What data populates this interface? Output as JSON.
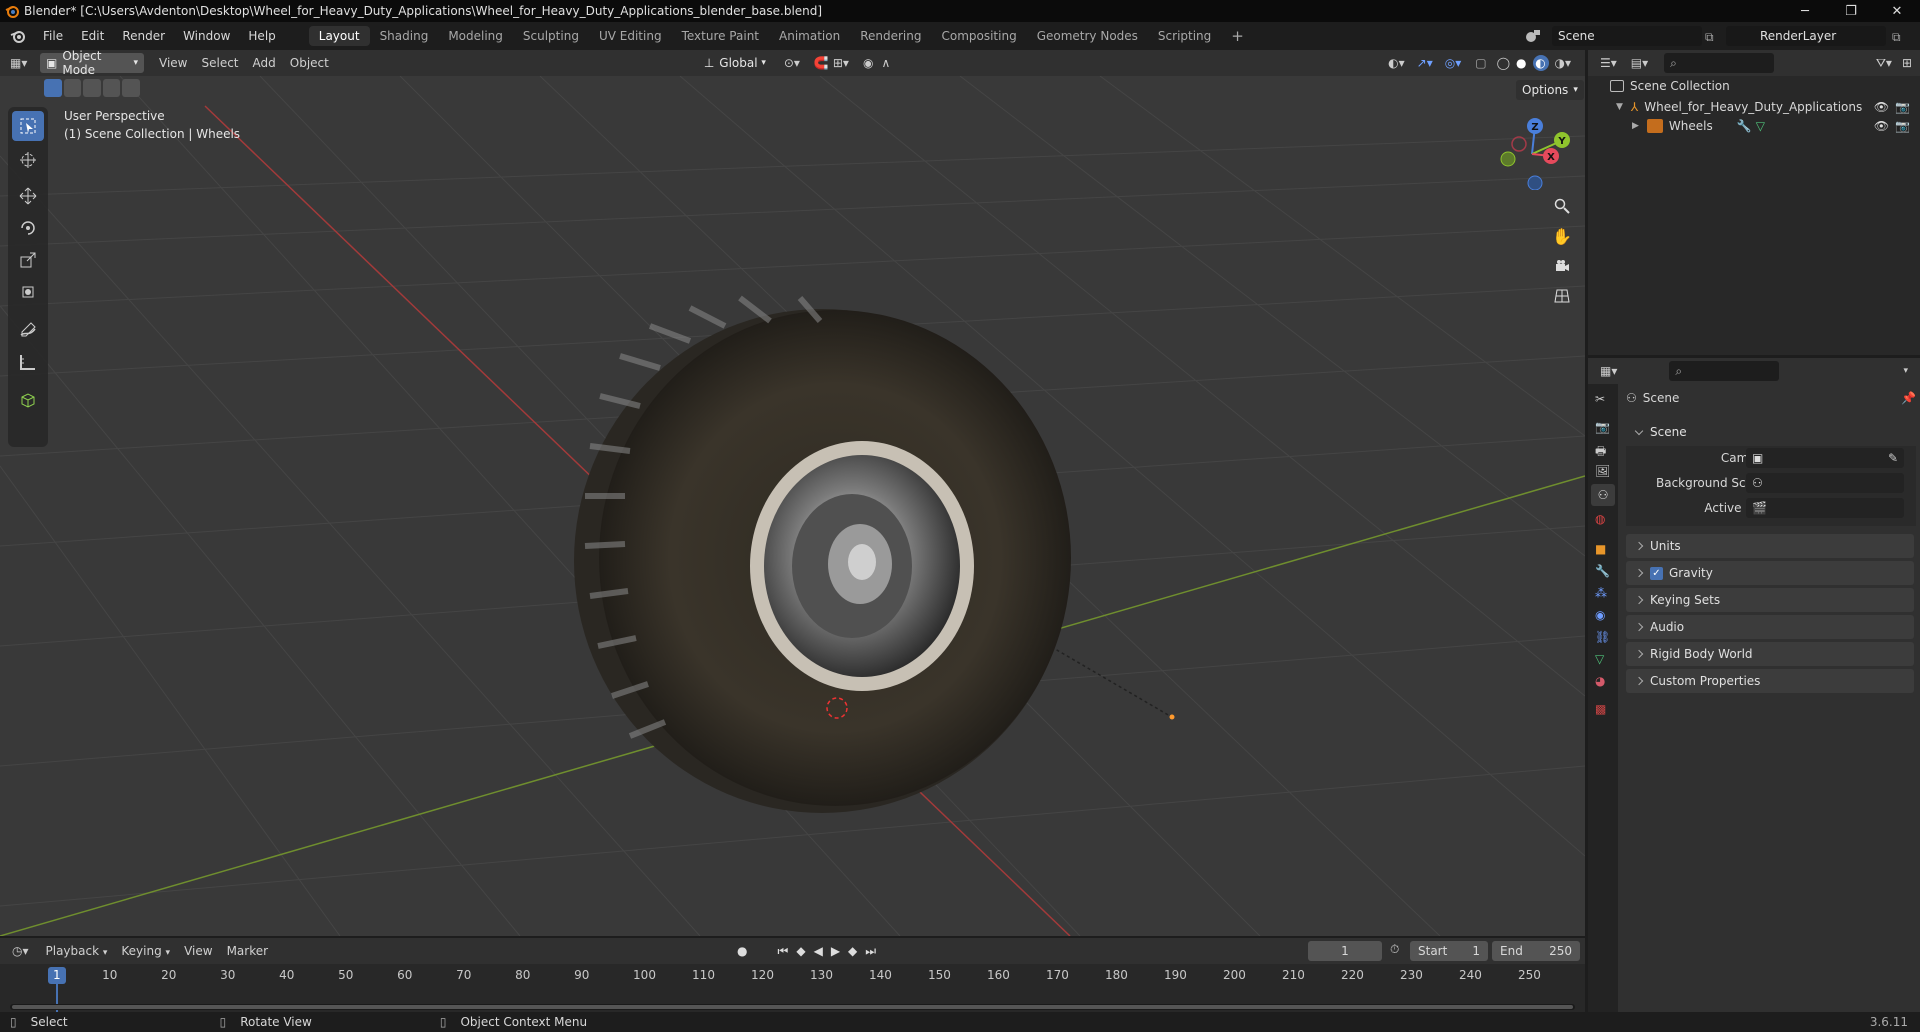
{
  "window": {
    "title": "Blender* [C:\\Users\\Avdenton\\Desktop\\Wheel_for_Heavy_Duty_Applications\\Wheel_for_Heavy_Duty_Applications_blender_base.blend]",
    "controls": [
      "─",
      "❐",
      "✕"
    ]
  },
  "menu": [
    "File",
    "Edit",
    "Render",
    "Window",
    "Help"
  ],
  "workspaces": [
    "Layout",
    "Shading",
    "Modeling",
    "Sculpting",
    "UV Editing",
    "Texture Paint",
    "Animation",
    "Rendering",
    "Compositing",
    "Geometry Nodes",
    "Scripting"
  ],
  "scene_field": "Scene",
  "renderlayer_field": "RenderLayer",
  "viewport_header": {
    "mode": "Object Mode",
    "menus": [
      "View",
      "Select",
      "Add",
      "Object"
    ],
    "transform_orientation": "Global",
    "options": "Options"
  },
  "viewport": {
    "perspective": "User Perspective",
    "collection": "(1) Scene Collection | Wheels"
  },
  "gizmo": {
    "z": "Z",
    "y": "Y",
    "x": "X"
  },
  "outliner": {
    "root": "Scene Collection",
    "items": [
      "Wheel_for_Heavy_Duty_Applications",
      "Wheels"
    ]
  },
  "properties": {
    "context": "Scene",
    "section": "Scene",
    "fields": [
      "Camera",
      "Background Scene",
      "Active Clip"
    ],
    "panels": [
      "Units",
      "Gravity",
      "Keying Sets",
      "Audio",
      "Rigid Body World",
      "Custom Properties"
    ]
  },
  "timeline": {
    "menus": [
      "Playback",
      "Keying",
      "View",
      "Marker"
    ],
    "current_frame": "1",
    "start_label": "Start",
    "start": "1",
    "end_label": "End",
    "end": "250",
    "ticks": [
      "1",
      "10",
      "20",
      "30",
      "40",
      "50",
      "60",
      "70",
      "80",
      "90",
      "100",
      "110",
      "120",
      "130",
      "140",
      "150",
      "160",
      "170",
      "180",
      "190",
      "200",
      "210",
      "220",
      "230",
      "240",
      "250"
    ]
  },
  "status": {
    "items": [
      "Select",
      "Rotate View",
      "Object Context Menu"
    ],
    "version": "3.6.11"
  }
}
